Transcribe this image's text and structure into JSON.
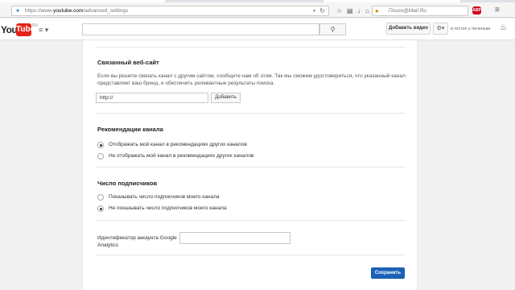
{
  "browser": {
    "url_prefix": "https://www.",
    "url_domain": "youtube.com",
    "url_path": "/advanced_settings",
    "search_placeholder": "Поиск@Mail.Ru",
    "abp_label": "ABP"
  },
  "header": {
    "logo_you": "You",
    "logo_tube": "Tube",
    "logo_region": "RU",
    "upload_label": "Добавить видео",
    "guest_label": "в гостях у печеньки"
  },
  "website": {
    "title": "Связанный веб-сайт",
    "description": "Если вы решите связать канал с другим сайтом, сообщите нам об этом. Так мы сможем удостовериться, что указанный канал представляет ваш бренд, и обеспечить релевантные результаты поиска.",
    "url_value": "http://",
    "add_label": "Добавить"
  },
  "recommendations": {
    "title": "Рекомендации канала",
    "options": [
      {
        "label": "Отображать мой канал в рекомендациях других каналов",
        "checked": true
      },
      {
        "label": "Не отображать мой канал в рекомендациях других каналов",
        "checked": false
      }
    ]
  },
  "subscribers": {
    "title": "Число подписчиков",
    "options": [
      {
        "label": "Показывать число подписчиков моего канала",
        "checked": false
      },
      {
        "label": "Не показывать число подписчиков моего канала",
        "checked": true
      }
    ]
  },
  "analytics": {
    "label": "Идентификатор аккаунта Google Analytics",
    "value": ""
  },
  "save_label": "Сохранить"
}
